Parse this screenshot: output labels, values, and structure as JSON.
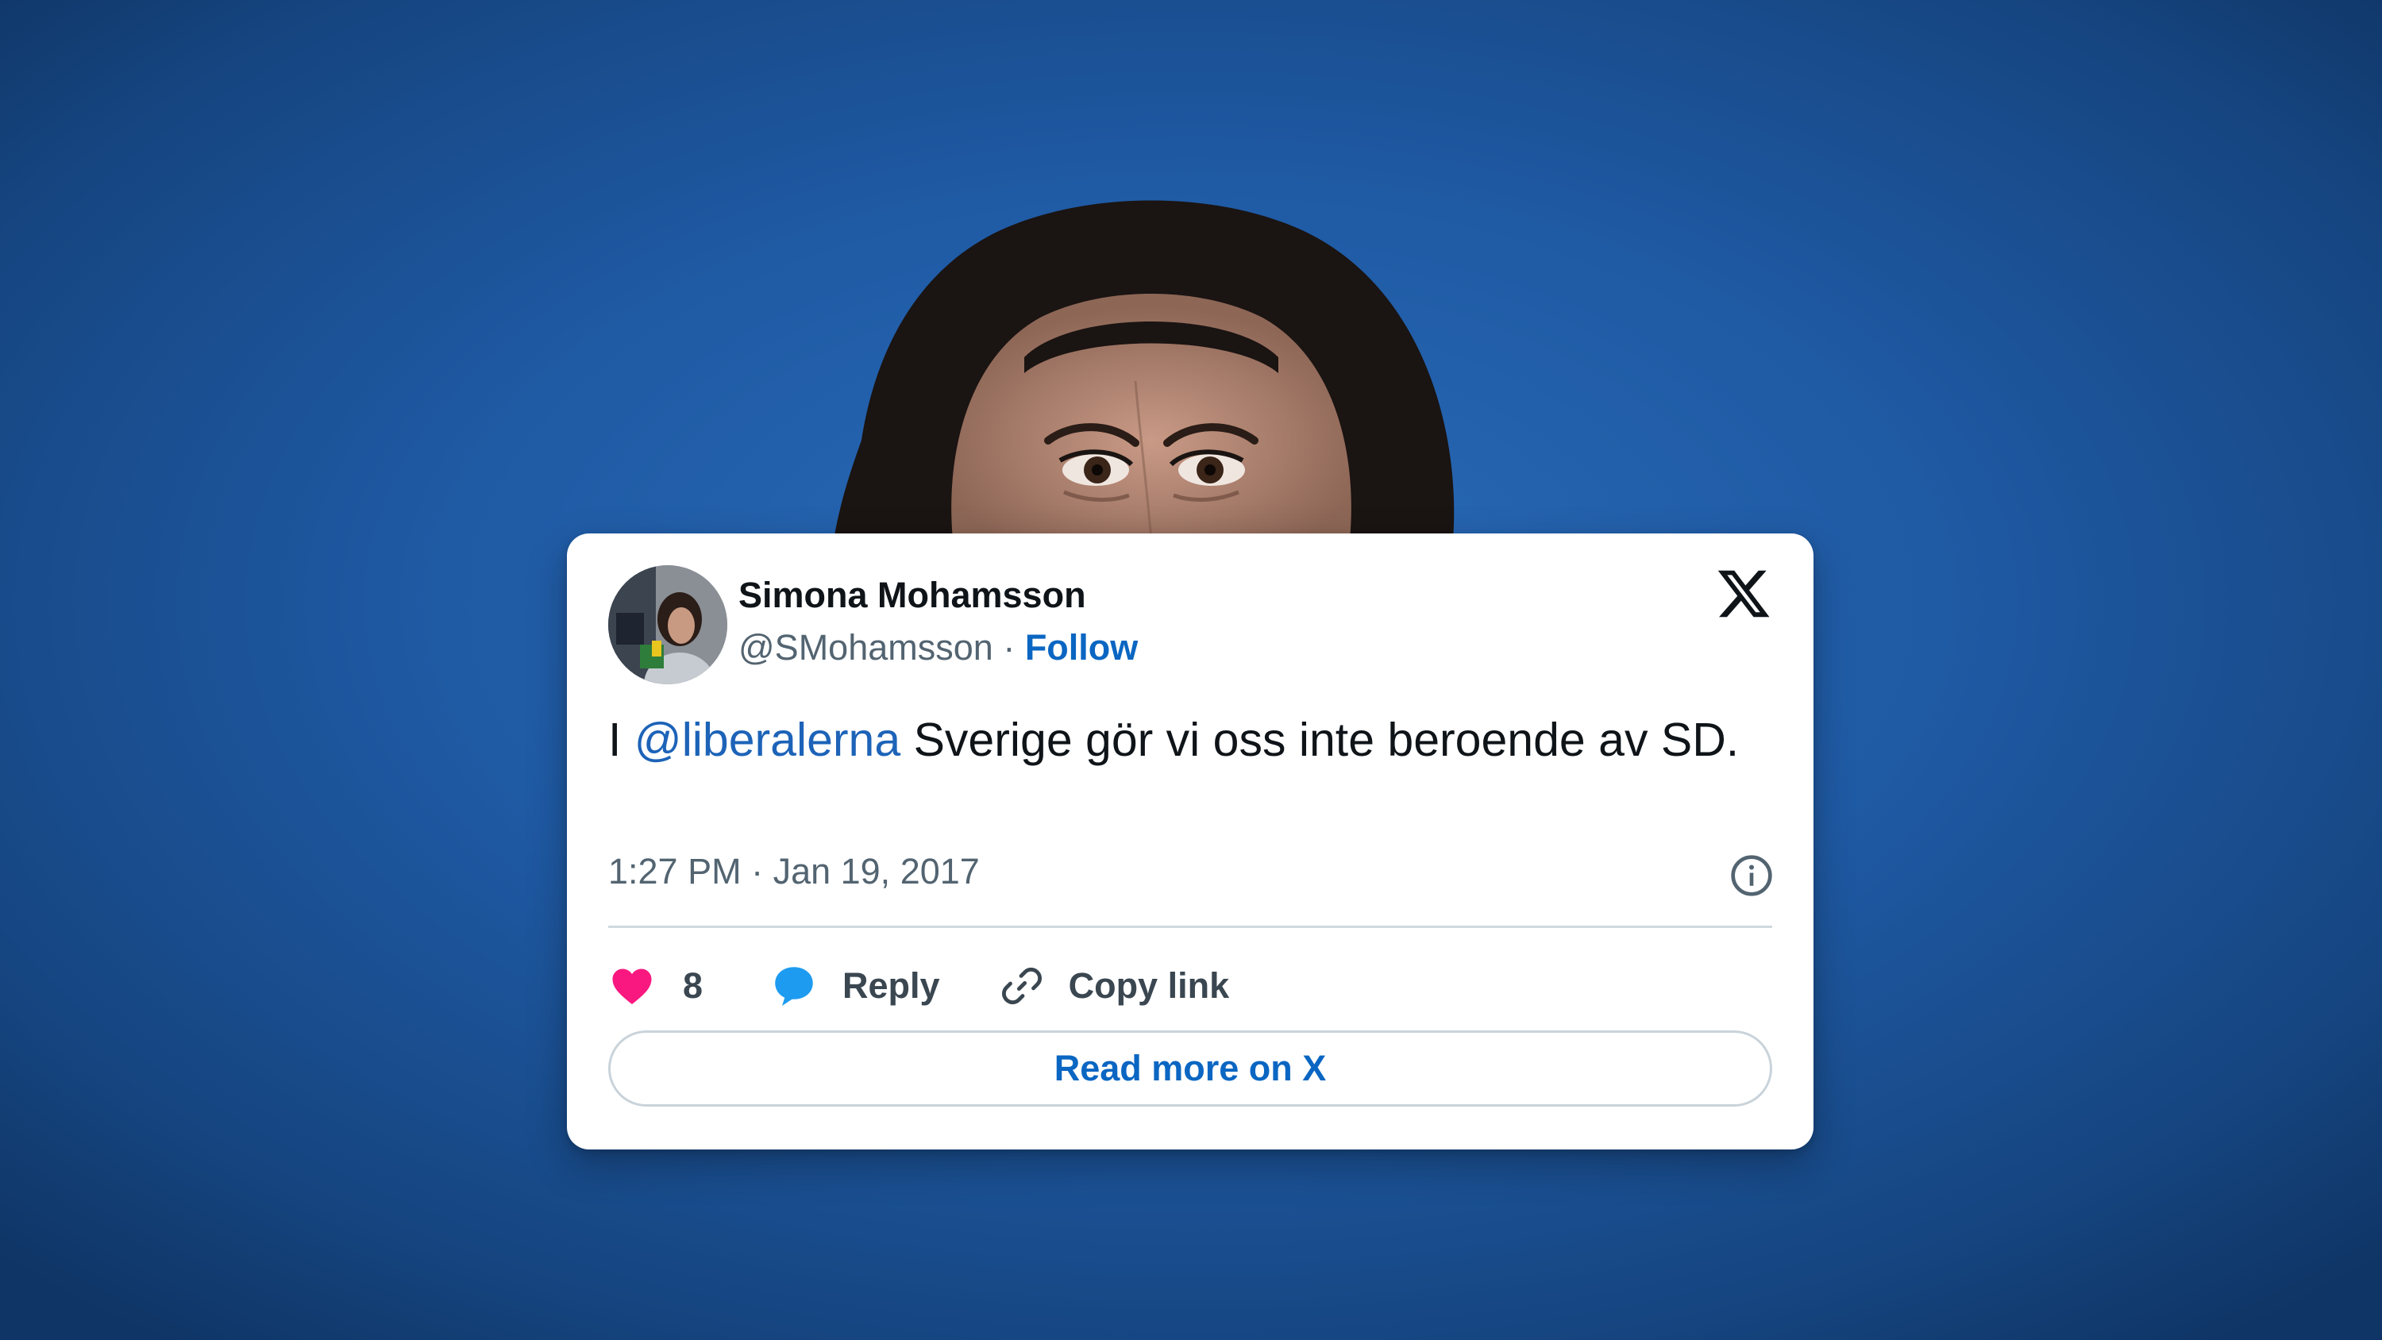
{
  "tweet": {
    "author_name": "Simona Mohamsson",
    "handle": "@SMohamsson",
    "separator": " · ",
    "follow_label": "Follow",
    "text_prefix": "I ",
    "mention": "@liberalerna",
    "text_rest": " Sverige gör vi oss inte beroende av SD.",
    "timestamp": "1:27 PM · Jan 19, 2017"
  },
  "actions": {
    "like_count": "8",
    "reply_label": "Reply",
    "copy_link_label": "Copy link"
  },
  "read_more_label": "Read more on X",
  "icons": [
    "heart-icon",
    "reply-icon",
    "link-icon",
    "info-icon",
    "x-logo"
  ],
  "colors": {
    "background": "#1f5aa4",
    "link_blue": "#0a66c2",
    "heart": "#f91880",
    "reply_bubble": "#1d9bf0"
  }
}
